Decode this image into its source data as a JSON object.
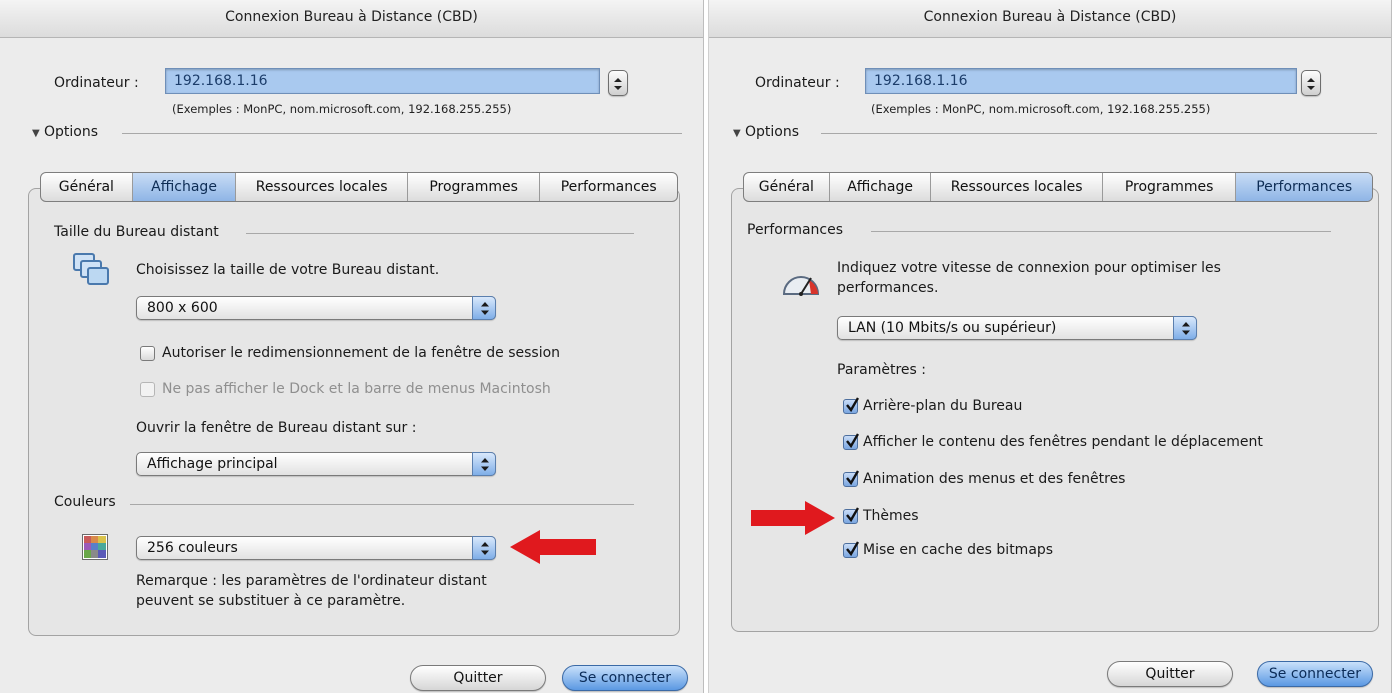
{
  "left": {
    "title": "Connexion Bureau à Distance (CBD)",
    "computer_label": "Ordinateur :",
    "computer_value": "192.168.1.16",
    "examples": "(Exemples : MonPC, nom.microsoft.com, 192.168.255.255)",
    "options_label": "Options",
    "tabs": [
      "Général",
      "Affichage",
      "Ressources locales",
      "Programmes",
      "Performances"
    ],
    "active_tab": "Affichage",
    "size_section": "Taille du Bureau distant",
    "size_instruction": "Choisissez la taille de votre Bureau distant.",
    "size_value": "800 x 600",
    "resize_checkbox": "Autoriser le redimensionnement de la fenêtre de session",
    "dock_checkbox": "Ne pas afficher le Dock et la barre de menus Macintosh",
    "open_on_label": "Ouvrir la fenêtre de Bureau distant sur :",
    "open_on_value": "Affichage principal",
    "colors_section": "Couleurs",
    "colors_value": "256 couleurs",
    "note_line1": "Remarque : les paramètres de l'ordinateur distant",
    "note_line2": "peuvent se substituer à ce paramètre.",
    "quit_button": "Quitter",
    "connect_button": "Se connecter"
  },
  "right": {
    "title": "Connexion Bureau à Distance (CBD)",
    "computer_label": "Ordinateur :",
    "computer_value": "192.168.1.16",
    "examples": "(Exemples : MonPC, nom.microsoft.com, 192.168.255.255)",
    "options_label": "Options",
    "tabs": [
      "Général",
      "Affichage",
      "Ressources locales",
      "Programmes",
      "Performances"
    ],
    "active_tab": "Performances",
    "perf_section": "Performances",
    "perf_instruction_line1": "Indiquez votre vitesse de connexion pour optimiser les",
    "perf_instruction_line2": "performances.",
    "speed_value": "LAN (10 Mbits/s ou supérieur)",
    "params_label": "Paramètres :",
    "params": [
      "Arrière-plan du Bureau",
      "Afficher le contenu des fenêtres pendant le déplacement",
      "Animation des menus et des fenêtres",
      "Thèmes",
      "Mise en cache des bitmaps"
    ],
    "quit_button": "Quitter",
    "connect_button": "Se connecter"
  },
  "colors": {
    "accent": "#8fb5e6",
    "field_highlight": "#a9c9ef",
    "annotation_arrow": "#e0191e"
  }
}
